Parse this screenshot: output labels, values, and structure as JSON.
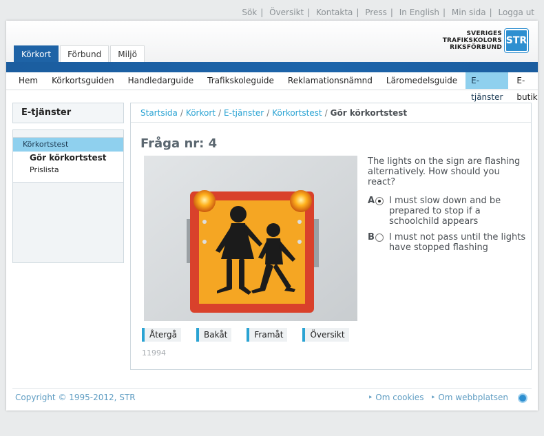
{
  "top_links": [
    "Sök",
    "Översikt",
    "Kontakta",
    "Press",
    "In English",
    "Min sida",
    "Logga ut"
  ],
  "tabs": [
    "Körkort",
    "Förbund",
    "Miljö"
  ],
  "logo": {
    "line1": "SVERIGES",
    "line2": "TRAFIKSKOLORS",
    "line3": "RIKSFÖRBUND",
    "mark": "STR"
  },
  "nav": [
    "Hem",
    "Körkortsguiden",
    "Handledarguide",
    "Trafikskoleguide",
    "Reklamationsnämnd",
    "Läromedelsguide",
    "E-tjänster",
    "E-butik"
  ],
  "sidebar": {
    "title": "E-tjänster",
    "section": "Körkortstest",
    "items": [
      "Gör körkortstest",
      "Prislista"
    ]
  },
  "breadcrumb": [
    "Startsida",
    "Körkort",
    "E-tjänster",
    "Körkortstest",
    "Gör körkortstest"
  ],
  "question": {
    "title": "Fråga nr: 4",
    "text": "The lights on the sign are flashing alternatively. How should you react?",
    "options": [
      {
        "letter": "A",
        "text": "I must slow down and be prepared to stop if a schoolchild appears",
        "selected": true
      },
      {
        "letter": "B",
        "text": "I must not pass until the lights have stopped flashing",
        "selected": false
      }
    ]
  },
  "buttons": [
    "Återgå",
    "Bakåt",
    "Framåt",
    "Översikt"
  ],
  "code": "11994",
  "footer": {
    "copyright": "Copyright © 1995-2012, STR",
    "links": [
      "Om cookies",
      "Om webbplatsen"
    ]
  },
  "colors": {
    "brand_blue": "#1e63a6",
    "accent_cyan": "#2aa3d3",
    "nav_active": "#8fd0ee",
    "sign_orange": "#f5a623",
    "sign_red": "#d9412b"
  }
}
